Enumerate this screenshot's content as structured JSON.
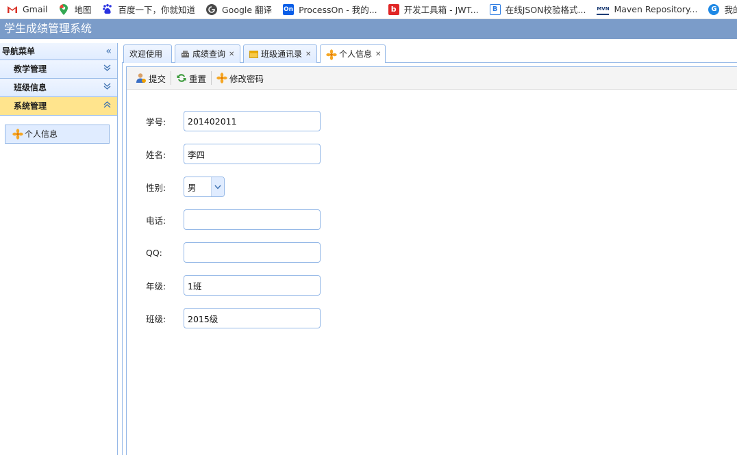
{
  "bookmarks": [
    {
      "label": "Gmail",
      "icon": "gmail-icon"
    },
    {
      "label": "地图",
      "icon": "maps-icon"
    },
    {
      "label": "百度一下，你就知道",
      "icon": "baidu-icon"
    },
    {
      "label": "Google 翻译",
      "icon": "google-translate-icon"
    },
    {
      "label": "ProcessOn - 我的...",
      "icon": "processon-icon"
    },
    {
      "label": "开发工具箱 - JWT...",
      "icon": "devtools-icon"
    },
    {
      "label": "在线JSON校验格式...",
      "icon": "json-icon"
    },
    {
      "label": "Maven Repository...",
      "icon": "maven-icon"
    },
    {
      "label": "我的地盘",
      "icon": "zentao-icon"
    }
  ],
  "app": {
    "title": "学生成绩管理系统"
  },
  "nav": {
    "title": "导航菜单",
    "items": [
      {
        "label": "教学管理",
        "active": false
      },
      {
        "label": "班级信息",
        "active": false
      },
      {
        "label": "系统管理",
        "active": true
      }
    ],
    "subitems": [
      {
        "label": "个人信息"
      }
    ]
  },
  "tabs": [
    {
      "label": "欢迎使用",
      "closable": false
    },
    {
      "label": "成绩查询",
      "closable": true
    },
    {
      "label": "班级通讯录",
      "closable": true
    },
    {
      "label": "个人信息",
      "closable": true,
      "active": true
    }
  ],
  "toolbar": {
    "submit": "提交",
    "reset": "重置",
    "change_password": "修改密码"
  },
  "form": {
    "student_id": {
      "label": "学号:",
      "value": "201402011"
    },
    "name": {
      "label": "姓名:",
      "value": "李四"
    },
    "gender": {
      "label": "性别:",
      "value": "男"
    },
    "phone": {
      "label": "电话:",
      "value": ""
    },
    "qq": {
      "label": "QQ:",
      "value": ""
    },
    "grade": {
      "label": "年级:",
      "value": "1班"
    },
    "class": {
      "label": "班级:",
      "value": "2015级"
    }
  },
  "colors": {
    "header": "#7b9cc9",
    "border": "#95b8e7",
    "active_menu": "#ffe48d",
    "tab_bg": "#e0ecff"
  }
}
